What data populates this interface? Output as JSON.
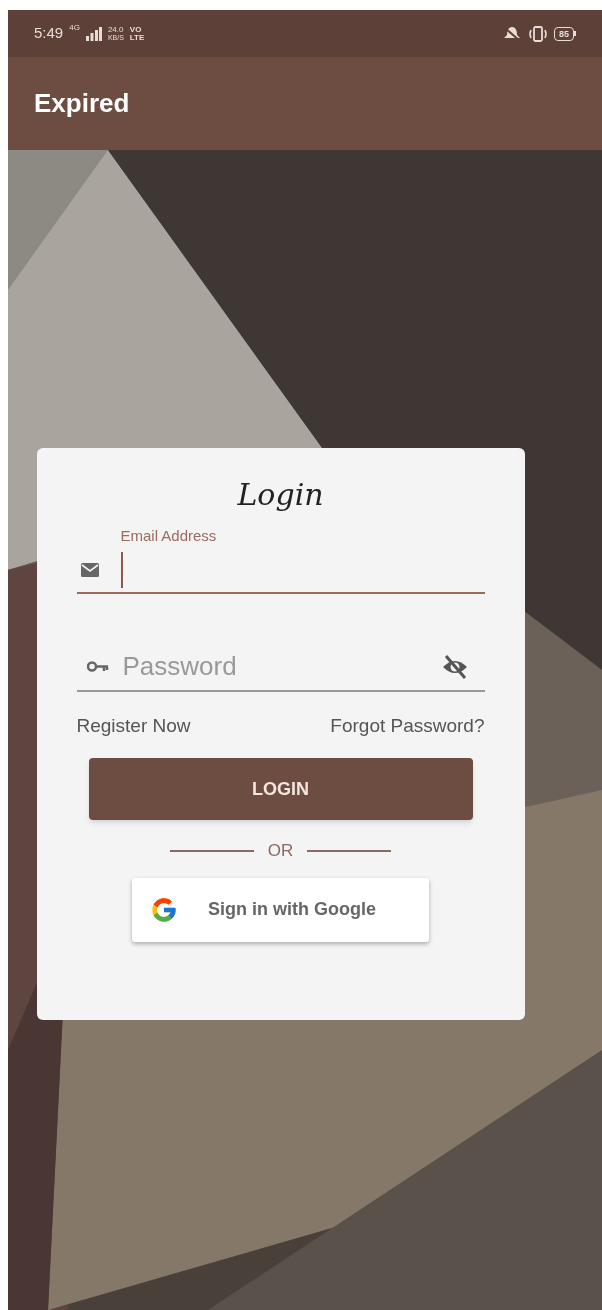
{
  "status_bar": {
    "time": "5:49",
    "network": "4G",
    "speed": "24.0",
    "speed_unit": "KB/S",
    "volte_top": "VO",
    "volte_bottom": "LTE",
    "battery": "85"
  },
  "app_bar": {
    "title": "Expired"
  },
  "login_card": {
    "title": "Login",
    "email": {
      "label": "Email Address",
      "focused": true
    },
    "password": {
      "placeholder": "Password",
      "visible": false,
      "focused": false
    },
    "register_link": "Register Now",
    "forgot_link": "Forgot Password?",
    "login_button": "LOGIN",
    "divider_text": "OR",
    "google_button": "Sign in with Google"
  }
}
